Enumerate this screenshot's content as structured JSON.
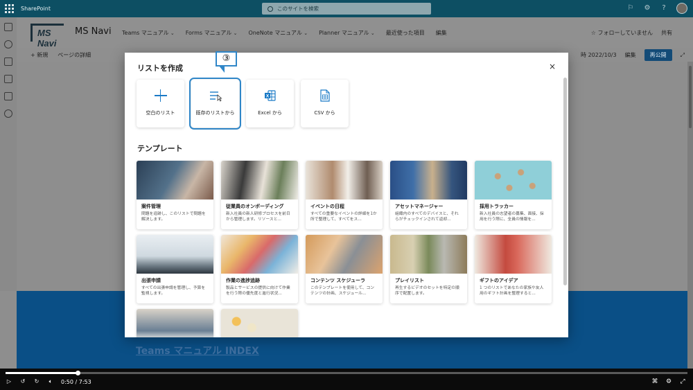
{
  "suitebar": {
    "app_name": "SharePoint",
    "search_placeholder": "このサイトを検索"
  },
  "site": {
    "logo_text": "MS Navi",
    "title": "MS Navi",
    "nav": [
      {
        "label": "Teams マニュアル"
      },
      {
        "label": "Forms マニュアル"
      },
      {
        "label": "OneNote マニュアル"
      },
      {
        "label": "Planner マニュアル"
      },
      {
        "label": "最近使った項目"
      },
      {
        "label": "編集"
      }
    ],
    "follow_label": "☆ フォローしていません",
    "share_label": "共有"
  },
  "commandbar": {
    "new_label": "+ 新規",
    "page_details_label": "ページの詳細",
    "date_label": "時 2022/10/3",
    "edit_label": "編集",
    "republish_label": "再公開"
  },
  "modal": {
    "title": "リストを作成",
    "close_icon": "×",
    "create_options": [
      {
        "label": "空白のリスト",
        "icon": "plus-icon"
      },
      {
        "label": "既存のリストから",
        "icon": "list-icon"
      },
      {
        "label": "Excel から",
        "icon": "excel-icon"
      },
      {
        "label": "CSV から",
        "icon": "csv-icon"
      }
    ],
    "callout_label": "③",
    "templates_heading": "テンプレート",
    "templates": [
      {
        "title": "案件管理",
        "desc": "問題を追跡し、このリストで問題を解決します。"
      },
      {
        "title": "従業員のオンボーディング",
        "desc": "新入社員の新人研修プロセスを前日から管理します。リソースと..."
      },
      {
        "title": "イベントの日程",
        "desc": "すべての重要なイベントの詳細を1か所で整理して、すべてをス..."
      },
      {
        "title": "アセットマネージャー",
        "desc": "組織内のすべてのデバイスと、それらがチェックインされて返却..."
      },
      {
        "title": "採用トラッカー",
        "desc": "新入社員の志望者の募集、面接、採用を行う際に、全員の情報を..."
      },
      {
        "title": "出張申請",
        "desc": "すべての出張申請を管理し、予算を監視します。"
      },
      {
        "title": "作業の進捗追跡",
        "desc": "製品とサービスの提供に向けて作業を行う際の優先度と進行状況..."
      },
      {
        "title": "コンテンツ スケジューラ",
        "desc": "このテンプレートを使用して、コンテンツの計画、スケジュール..."
      },
      {
        "title": "プレイリスト",
        "desc": "再生するビデオのセットを特定の順序で配置します。"
      },
      {
        "title": "ギフトのアイデア",
        "desc": "1 つのリストであなたの家族や友人用のギフト計画を整理すると..."
      }
    ]
  },
  "page": {
    "index_link": "Teams マニュアル INDEX"
  },
  "video": {
    "time": "0:50 / 7:53",
    "progress": 0.106
  }
}
